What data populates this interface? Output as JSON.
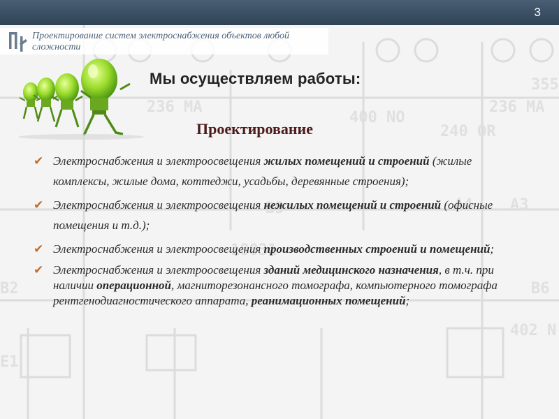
{
  "header": {
    "slide_number": "3",
    "subtitle": "Проектирование систем электроснабжения объектов любой сложности"
  },
  "heading": "Мы осуществляем работы:",
  "section_title": "Проектирование",
  "items": [
    {
      "parts": [
        {
          "t": "Электроснабжения и электроосвещения ",
          "b": false
        },
        {
          "t": "жилых помещений и строений",
          "b": true
        },
        {
          "t": " (жилые комплексы, жилые дома, коттеджи, усадьбы, деревянные строения);",
          "b": false
        }
      ]
    },
    {
      "parts": [
        {
          "t": "Электроснабжения и электроосвещения ",
          "b": false
        },
        {
          "t": "нежилых помещений и строений",
          "b": true
        },
        {
          "t": " (офисные помещения и т.д.);",
          "b": false
        }
      ]
    },
    {
      "parts": [
        {
          "t": "Электроснабжения и электроосвещения ",
          "b": false
        },
        {
          "t": "производственных строений и помещений",
          "b": true
        },
        {
          "t": ";",
          "b": false
        }
      ]
    },
    {
      "parts": [
        {
          "t": "Электроснабжения и электроосвещения ",
          "b": false
        },
        {
          "t": "зданий медицинского назначения",
          "b": true
        },
        {
          "t": ", в т.ч. при наличии ",
          "b": false
        },
        {
          "t": "операционной",
          "b": true
        },
        {
          "t": ", магниторезонансного томографа, компьютерного томографа рентгенодиагностического аппарата, ",
          "b": false
        },
        {
          "t": "реанимационных помещений",
          "b": true
        },
        {
          "t": ";",
          "b": false
        }
      ]
    }
  ],
  "icons": {
    "bullet": "checkmark-icon",
    "logo": "company-logo",
    "illustration": "walking-lightbulbs-illustration"
  },
  "colors": {
    "header_bar": "#2f4256",
    "subtitle_text": "#4f6378",
    "section_title": "#4d1a1a",
    "bullet": "#c06c2a",
    "bulb_green": "#8fd12a"
  }
}
